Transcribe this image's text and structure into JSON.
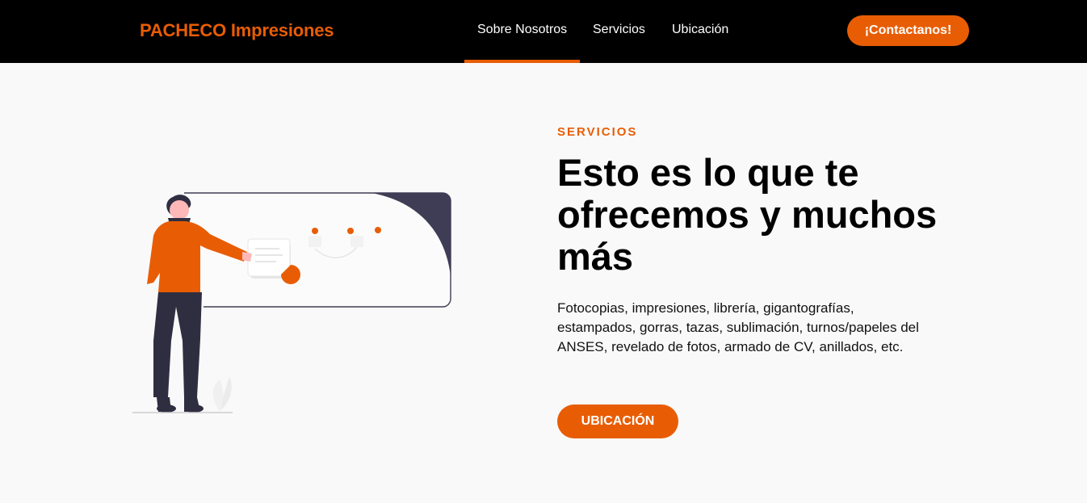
{
  "header": {
    "brand": "PACHECO Impresiones",
    "nav": [
      {
        "label": "Sobre Nosotros",
        "active": true
      },
      {
        "label": "Servicios",
        "active": false
      },
      {
        "label": "Ubicación",
        "active": false
      }
    ],
    "cta_label": "¡Contactanos!"
  },
  "hero": {
    "eyebrow": "SERVICIOS",
    "headline": "Esto es lo que te ofrecemos y muchos más",
    "description": "Fotocopias, impresiones, librería, gigantografías, estampados, gorras, tazas, sublimación, turnos/papeles del ANSES, revelado de fotos, armado de CV, anillados, etc.",
    "button_label": "UBICACIÓN",
    "illustration": "person-presenting-board-illustration"
  },
  "colors": {
    "accent": "#e85d04",
    "header_bg": "#000000",
    "page_bg": "#f9f9f9",
    "illustration_dark": "#3f3d56",
    "illustration_pants": "#2f2e41"
  }
}
